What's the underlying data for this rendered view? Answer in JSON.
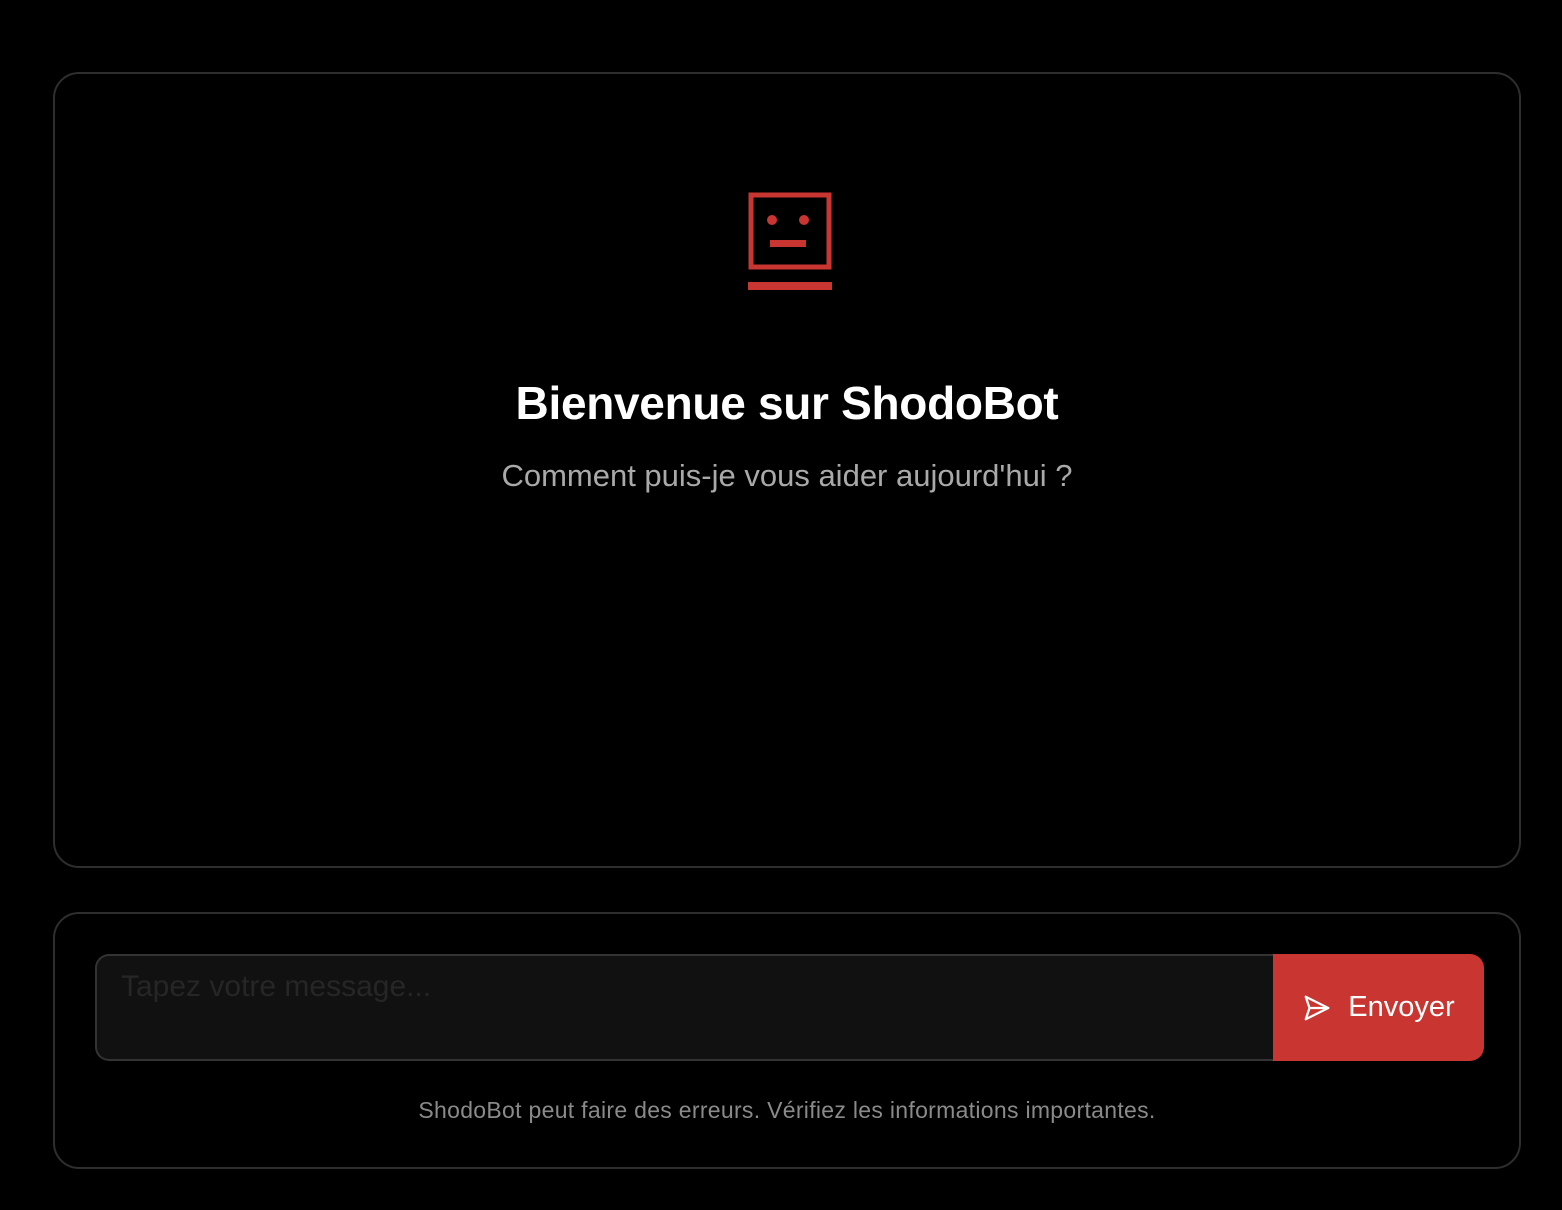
{
  "welcome": {
    "icon": "robot-face-icon",
    "title": "Bienvenue sur ShodoBot",
    "subtitle": "Comment puis-je vous aider aujourd'hui ?"
  },
  "composer": {
    "placeholder": "Tapez votre message...",
    "value": "",
    "send_icon": "send-icon",
    "send_label": "Envoyer",
    "disclaimer": "ShodoBot peut faire des erreurs. Vérifiez les informations importantes."
  },
  "colors": {
    "background": "#000000",
    "accent": "#c93631",
    "panel_border": "#2e2e2e",
    "input_background": "#111111"
  }
}
